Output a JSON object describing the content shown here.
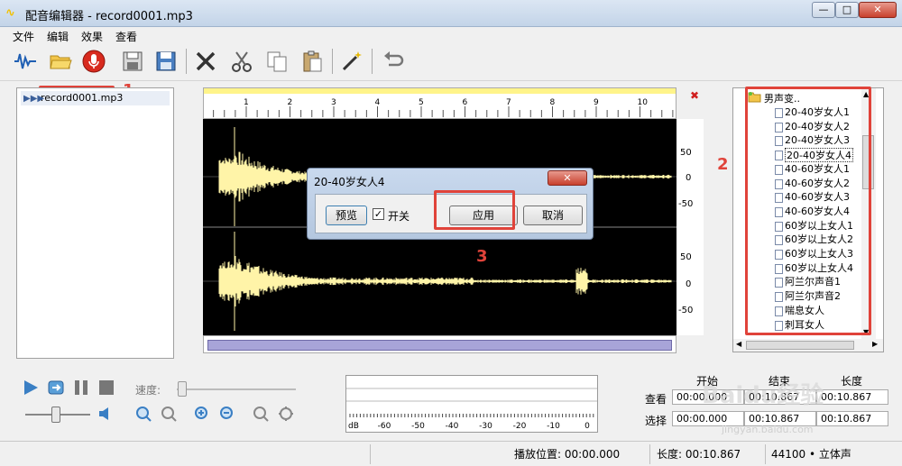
{
  "window": {
    "title": "配音编辑器 - record0001.mp3",
    "minimize": "—",
    "restore": "□",
    "close": "✕"
  },
  "menu": [
    "文件",
    "编辑",
    "效果",
    "查看"
  ],
  "annotations": {
    "a1": "1",
    "a2": "2",
    "a3": "3"
  },
  "files": [
    {
      "name": "record0001.mp3"
    }
  ],
  "ruler": {
    "ticks": [
      "1",
      "2",
      "3",
      "4",
      "5",
      "6",
      "7",
      "8",
      "9",
      "10"
    ]
  },
  "scale": {
    "ch1": [
      "50",
      "0",
      "-50"
    ],
    "ch2": [
      "50",
      "0",
      "-50"
    ]
  },
  "close_wave": "✖",
  "tree": {
    "root": "男声变..",
    "items": [
      "20-40岁女人1",
      "20-40岁女人2",
      "20-40岁女人3",
      "20-40岁女人4",
      "40-60岁女人1",
      "40-60岁女人2",
      "40-60岁女人3",
      "40-60岁女人4",
      "60岁以上女人1",
      "60岁以上女人2",
      "60岁以上女人3",
      "60岁以上女人4",
      "阿兰尔声音1",
      "阿兰尔声音2",
      "喘息女人",
      "刺耳女人"
    ],
    "selected_index": 3
  },
  "dialog": {
    "title": "20-40岁女人4",
    "close": "✕",
    "preview": "预览",
    "toggle": "开关",
    "toggle_checked": true,
    "apply": "应用",
    "cancel": "取消"
  },
  "transport": {
    "speed_label": "速度:"
  },
  "meter": {
    "db_label": "dB",
    "ticks": [
      "-60",
      "-50",
      "-40",
      "-30",
      "-20",
      "-10",
      "0"
    ]
  },
  "times": {
    "headers": {
      "start": "开始",
      "end": "结束",
      "length": "长度"
    },
    "view": {
      "label": "查看",
      "start": "00:00.000",
      "end": "00:10.867",
      "length": "00:10.867"
    },
    "select": {
      "label": "选择",
      "start": "00:00.000",
      "end": "00:10.867",
      "length": "00:10.867"
    }
  },
  "status": {
    "position": "播放位置: 00:00.000",
    "length": "长度: 00:10.867",
    "format": "44100 • 立体声"
  },
  "watermark": {
    "main": "Baidu经验",
    "sub": "jingyan.baidu.com"
  },
  "colors": {
    "accent_red": "#e0433a",
    "wave": "#fff4a8",
    "wave_bg": "#000000"
  }
}
